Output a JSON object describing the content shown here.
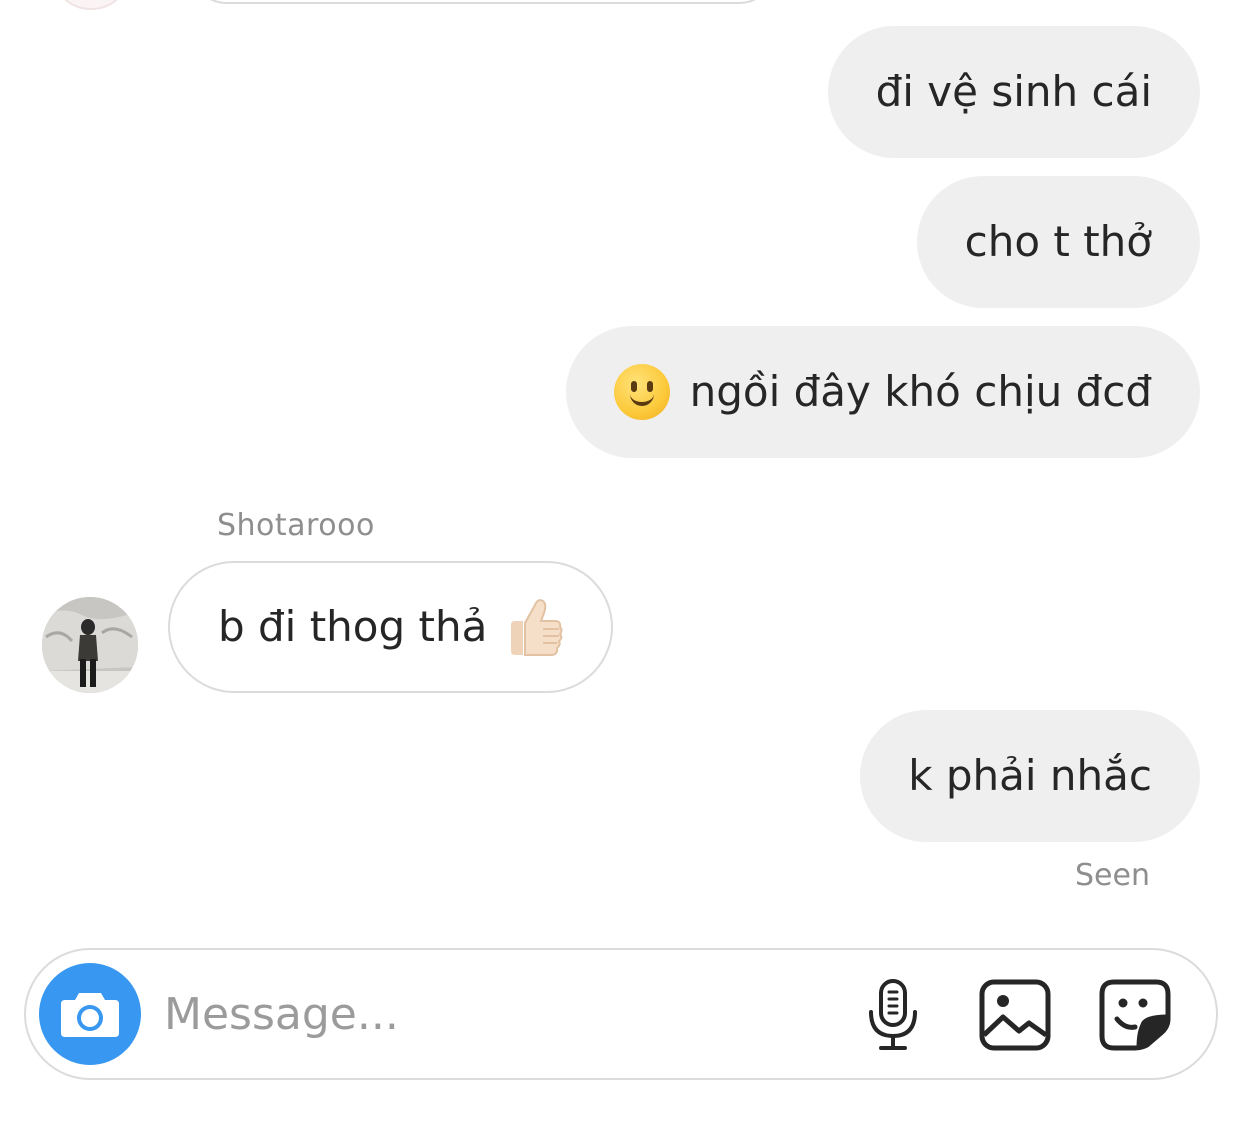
{
  "messages": [
    {
      "direction": "outgoing",
      "text": "đi vệ sinh cái"
    },
    {
      "direction": "outgoing",
      "text": "cho t thở"
    },
    {
      "direction": "outgoing",
      "emoji": "slightly-smiling-face-emoji",
      "text": "ngồi đây khó chịu đcđ"
    },
    {
      "direction": "incoming",
      "sender": "Shotarooo",
      "text": "b đi thog thả",
      "emoji": "thumbs-up-emoji"
    },
    {
      "direction": "outgoing",
      "text": "k phải nhắc"
    }
  ],
  "status": {
    "seen": "Seen"
  },
  "composer": {
    "placeholder": "Message...",
    "icons": [
      "camera-icon",
      "microphone-icon",
      "gallery-icon",
      "sticker-icon"
    ],
    "camera_color": "#3897f0"
  },
  "colors": {
    "outgoing_bubble": "#efefef",
    "incoming_border": "#dbdbdb",
    "muted_text": "#8e8e8e",
    "text": "#262626"
  }
}
